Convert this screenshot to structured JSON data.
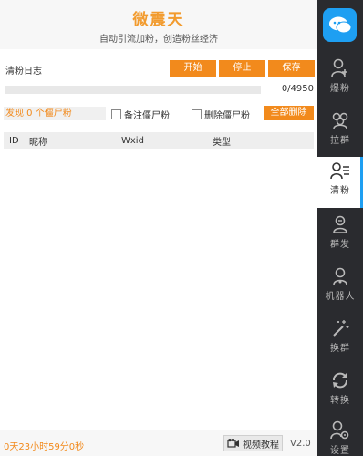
{
  "header": {
    "title": "微震天",
    "subtitle": "自动引流加粉，创造粉丝经济"
  },
  "clean_log": {
    "title": "清粉日志",
    "buttons": {
      "start": "开始",
      "stop": "停止",
      "save": "保存"
    },
    "progress": {
      "current": 0,
      "total": 4950,
      "text": "0/4950"
    },
    "found_text": "发现 0 个僵尸粉",
    "checkbox_note": {
      "label": "备注僵尸粉",
      "checked": false
    },
    "checkbox_delete": {
      "label": "删除僵尸粉",
      "checked": false
    },
    "delete_all": "全部删除",
    "table": {
      "columns": [
        "ID",
        "昵称",
        "Wxid",
        "类型"
      ],
      "rows": []
    }
  },
  "footer": {
    "timer": "0天23小时59分0秒",
    "tutorial": "视频教程",
    "version": "V2.0"
  },
  "sidebar": {
    "items": [
      {
        "label": "爆粉",
        "icon": "user-add-icon",
        "active": false
      },
      {
        "label": "拉群",
        "icon": "group-icon",
        "active": false
      },
      {
        "label": "清粉",
        "icon": "user-list-icon",
        "active": true
      },
      {
        "label": "群发",
        "icon": "broadcast-user-icon",
        "active": false
      },
      {
        "label": "机器人",
        "icon": "robot-user-icon",
        "active": false
      },
      {
        "label": "换群",
        "icon": "magic-wand-icon",
        "active": false
      },
      {
        "label": "转换",
        "icon": "refresh-icon",
        "active": false
      },
      {
        "label": "设置",
        "icon": "user-settings-icon",
        "active": false
      }
    ]
  },
  "colors": {
    "accent": "#f28a1c",
    "title": "#f29b2e",
    "sidebar_bg": "#2a2b2f",
    "logo_bg": "#1e9ff2"
  }
}
